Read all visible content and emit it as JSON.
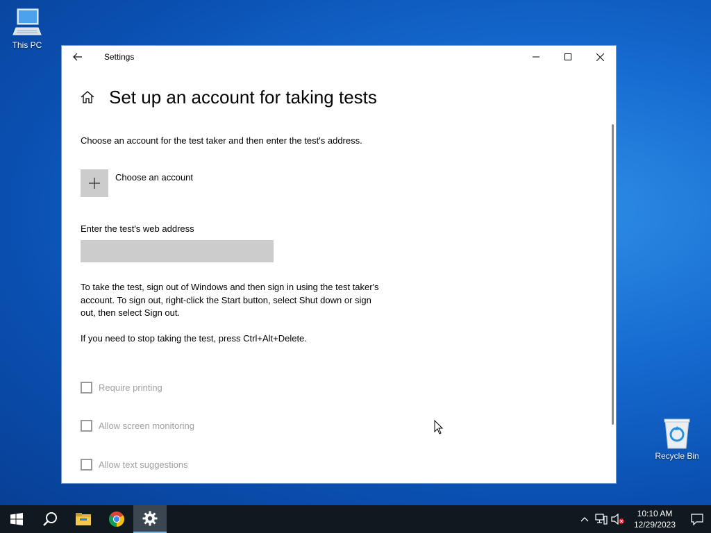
{
  "desktop": {
    "icons": [
      {
        "label": "This PC"
      },
      {
        "label": "Recycle Bin"
      }
    ]
  },
  "window": {
    "title": "Settings",
    "controls": {
      "minimize": "minimize",
      "maximize": "maximize",
      "close": "close"
    }
  },
  "page": {
    "title": "Set up an account for taking tests",
    "intro": "Choose an account for the test taker and then enter the test's address.",
    "choose_account_label": "Choose an account",
    "address_label": "Enter the test's web address",
    "address_value": "",
    "info_paragraph_1": "To take the test, sign out of Windows and then sign in using the test taker's account. To sign out, right-click the Start button, select Shut down or sign out, then select Sign out.",
    "info_paragraph_2": "If you need to stop taking the test, press Ctrl+Alt+Delete.",
    "options": [
      {
        "label": "Require printing",
        "checked": false,
        "enabled": false
      },
      {
        "label": "Allow screen monitoring",
        "checked": false,
        "enabled": false
      },
      {
        "label": "Allow text suggestions",
        "checked": false,
        "enabled": false
      }
    ]
  },
  "taskbar": {
    "apps": [
      "start-icon",
      "search-icon",
      "file-explorer-icon",
      "chrome-icon",
      "settings-icon"
    ],
    "active_app": "settings-icon",
    "clock": {
      "time": "10:10 AM",
      "date": "12/29/2023"
    }
  },
  "colors": {
    "accent": "#0078d7",
    "desktop_blue": "#1569cf",
    "taskbar_bg": "#101820",
    "disabled_text": "#a0a0a0"
  }
}
